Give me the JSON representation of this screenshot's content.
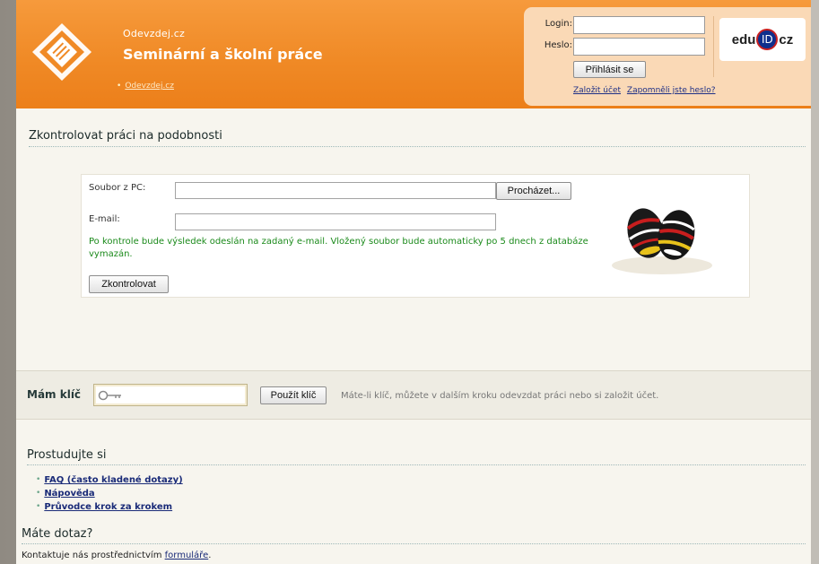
{
  "header": {
    "site_name": "Odevzdej.cz",
    "title": "Seminární a školní práce",
    "breadcrumb": "Odevzdej.cz"
  },
  "login": {
    "login_label": "Login:",
    "password_label": "Heslo:",
    "login_value": "",
    "password_value": "",
    "submit_label": "Přihlásit se",
    "register_link": "Založit účet",
    "forgot_link": "Zapomněli jste heslo?"
  },
  "eduid": {
    "left": "edu",
    "mid": "ID",
    "right": "cz"
  },
  "check": {
    "heading": "Zkontrolovat práci na podobnosti",
    "file_label": "Soubor z PC:",
    "file_value": "",
    "browse_label": "Procházet...",
    "email_label": "E-mail:",
    "email_value": "",
    "notice": "Po kontrole bude výsledek odeslán na zadaný e-mail. Vložený soubor bude automaticky po 5 dnech z databáze vymazán.",
    "submit_label": "Zkontrolovat"
  },
  "key": {
    "label": "Mám klíč",
    "value": "",
    "button_label": "Použít klíč",
    "hint": "Máte-li klíč, můžete v dalším kroku odevzdat práci nebo si založit účet."
  },
  "study": {
    "heading": "Prostudujte si",
    "links": [
      "FAQ (často kladené dotazy)",
      "Nápověda",
      "Průvodce krok za krokem"
    ]
  },
  "question": {
    "heading": "Máte dotaz?",
    "text": "Kontaktuje nás prostřednictvím",
    "link": "formuláře",
    "suffix": "."
  },
  "colors": {
    "header_orange": "#f08a26",
    "login_panel": "#fad9b6",
    "heading_text": "#1c2b2a",
    "notice_green": "#1b8a1b",
    "link_blue": "#1a2b78"
  }
}
